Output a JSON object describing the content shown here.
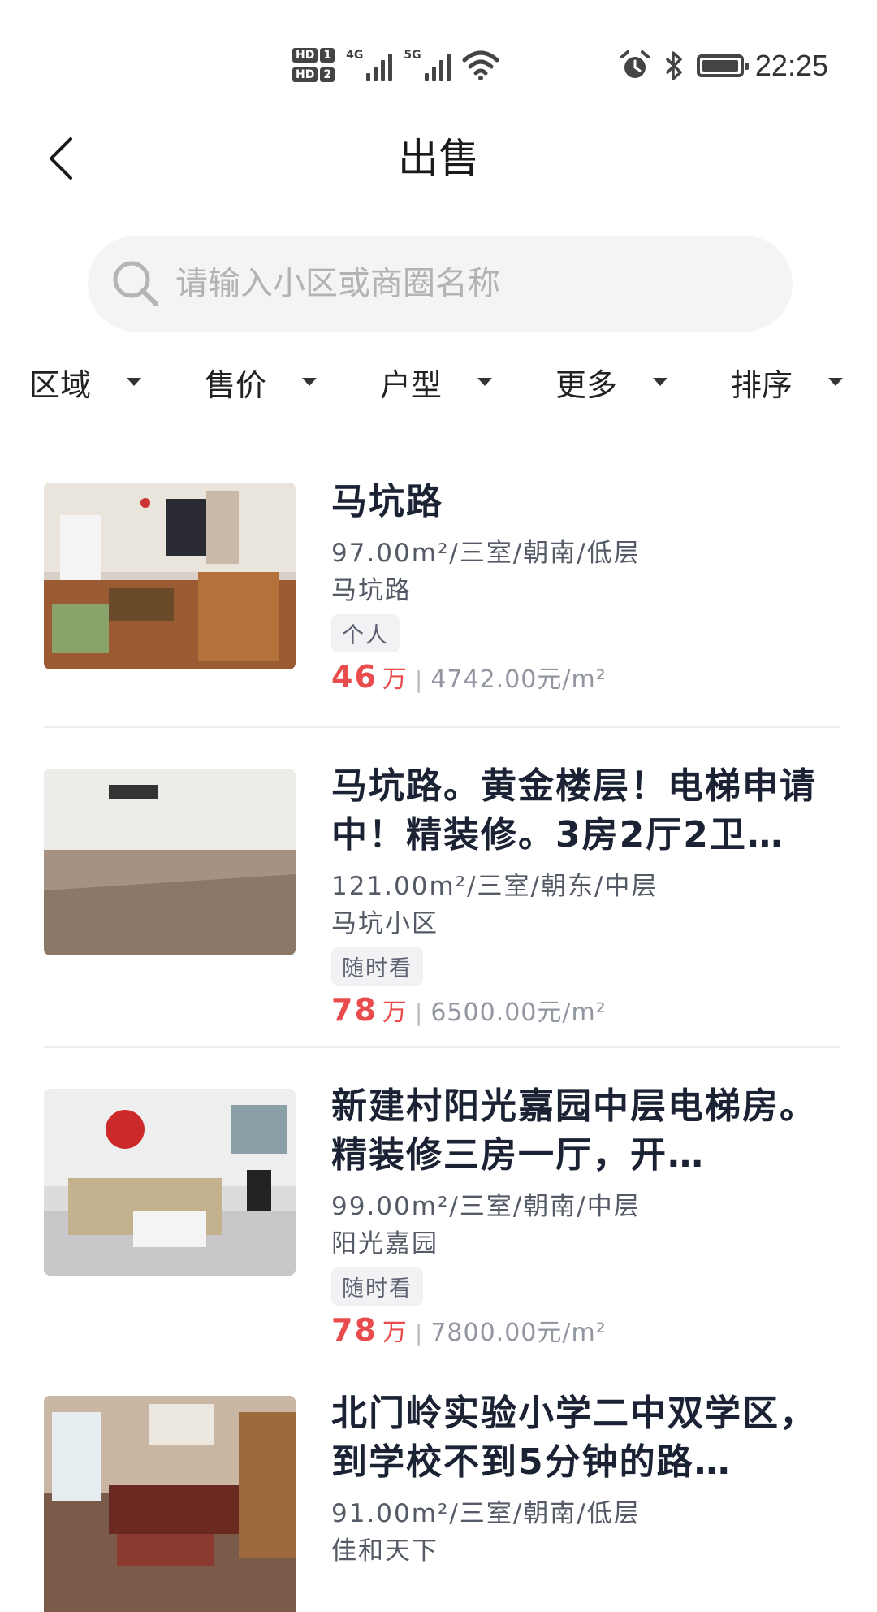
{
  "status_bar": {
    "hd1": "HD",
    "hd1_num": "1",
    "hd2": "HD",
    "hd2_num": "2",
    "net1": "4G",
    "net2": "5G",
    "time": "22:25"
  },
  "header": {
    "title": "出售"
  },
  "search": {
    "placeholder": "请输入小区或商圈名称"
  },
  "filters": [
    {
      "label": "区域"
    },
    {
      "label": "售价"
    },
    {
      "label": "户型"
    },
    {
      "label": "更多"
    },
    {
      "label": "排序"
    }
  ],
  "listings": [
    {
      "title": "马坑路",
      "spec": "97.00m²/三室/朝南/低层",
      "community": "马坑路",
      "tag": "个人",
      "price": "46",
      "price_unit": "万",
      "separator": "|",
      "price_per_sqm": "4742.00元/m²"
    },
    {
      "title": "马坑路。黄金楼层！电梯申请中！精装修。3房2厅2卫…",
      "spec": "121.00m²/三室/朝东/中层",
      "community": "马坑小区",
      "tag": "随时看",
      "price": "78",
      "price_unit": "万",
      "separator": "|",
      "price_per_sqm": "6500.00元/m²"
    },
    {
      "title": "新建村阳光嘉园中层电梯房。精装修三房一厅，开…",
      "spec": "99.00m²/三室/朝南/中层",
      "community": "阳光嘉园",
      "tag": "随时看",
      "price": "78",
      "price_unit": "万",
      "separator": "|",
      "price_per_sqm": "7800.00元/m²"
    },
    {
      "title": "北门岭实验小学二中双学区，到学校不到5分钟的路…",
      "spec": "91.00m²/三室/朝南/低层",
      "community": "佳和天下",
      "tag": "",
      "price": "",
      "price_unit": "",
      "separator": "",
      "price_per_sqm": ""
    }
  ]
}
